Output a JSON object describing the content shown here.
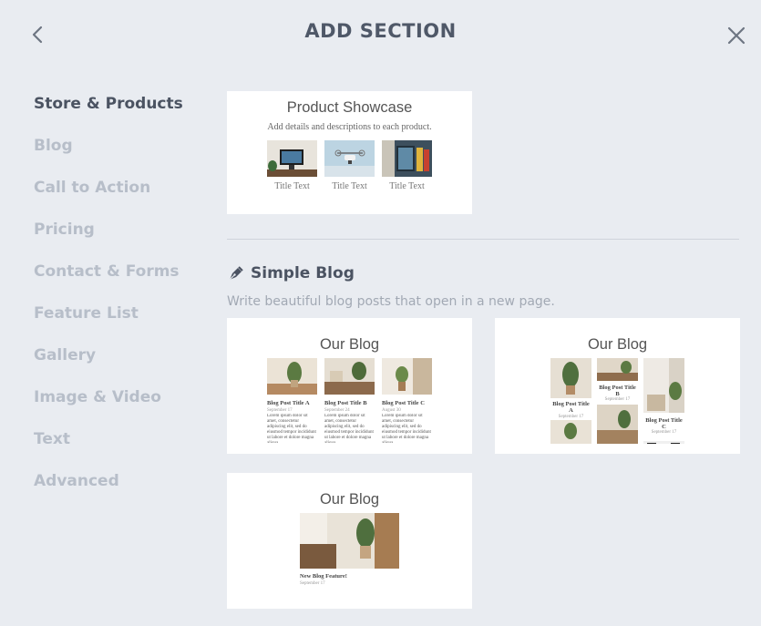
{
  "header": {
    "title": "ADD SECTION"
  },
  "sidebar": {
    "items": [
      {
        "label": "Store & Products",
        "active": true
      },
      {
        "label": "Blog"
      },
      {
        "label": "Call to Action"
      },
      {
        "label": "Pricing"
      },
      {
        "label": "Contact & Forms"
      },
      {
        "label": "Feature List"
      },
      {
        "label": "Gallery"
      },
      {
        "label": "Image & Video"
      },
      {
        "label": "Text"
      },
      {
        "label": "Advanced"
      }
    ]
  },
  "product_showcase": {
    "title": "Product Showcase",
    "subtitle": "Add details and descriptions to each product.",
    "items": [
      {
        "caption": "Title Text"
      },
      {
        "caption": "Title Text"
      },
      {
        "caption": "Title Text"
      }
    ]
  },
  "simple_blog": {
    "heading": "Simple Blog",
    "icon": "pen-nib-icon",
    "description": "Write beautiful blog posts that open in a new page.",
    "layout_grid": {
      "title": "Our Blog",
      "posts": [
        {
          "title": "Blog Post Title A",
          "date": "September 17",
          "body": "Lorem ipsum dolor sit amet, consectetur adipiscing elit, sed do eiusmod tempor incididunt ut labore et dolore magna aliqua."
        },
        {
          "title": "Blog Post Title B",
          "date": "September 24",
          "body": "Lorem ipsum dolor sit amet, consectetur adipiscing elit, sed do eiusmod tempor incididunt ut labore et dolore magna aliqua."
        },
        {
          "title": "Blog Post Title C",
          "date": "August 30",
          "body": "Lorem ipsum dolor sit amet, consectetur adipiscing elit, sed do eiusmod tempor incididunt ut labore et dolore magna aliqua."
        }
      ]
    },
    "layout_masonry": {
      "title": "Our Blog",
      "posts": [
        {
          "title": "Blog Post Title A",
          "date": "September 17"
        },
        {
          "title": "Blog Post Title B",
          "date": "September 17"
        },
        {
          "title": "Blog Post Title C",
          "date": "September 17"
        }
      ]
    },
    "layout_featured": {
      "title": "Our Blog",
      "post": {
        "title": "New Blog Feature!",
        "date": "September 17"
      }
    }
  }
}
